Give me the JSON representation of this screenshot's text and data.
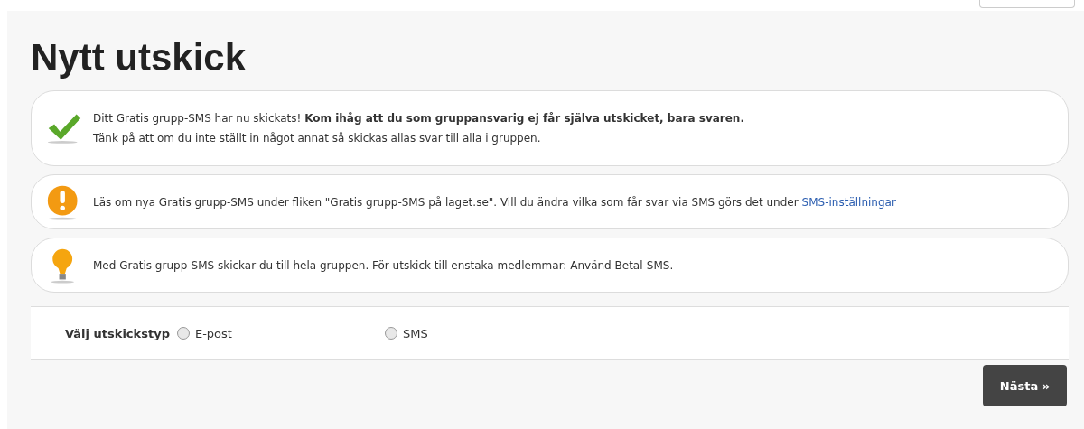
{
  "title": "Nytt utskick",
  "notices": [
    {
      "kind": "success",
      "lines": [
        "Ditt Gratis grupp-SMS har nu skickats! **Kom ihåg att du som gruppansvarig ej får själva utskicket, bara svaren.**",
        "Tänk på att om du inte ställt in något annat så skickas allas svar till alla i gruppen."
      ]
    },
    {
      "kind": "warning",
      "lines": [
        "Läs om nya Gratis grupp-SMS under fliken \"Gratis grupp-SMS på laget.se\". Vill du ändra vilka som får svar via SMS görs det under"
      ],
      "link": "SMS-inställningar"
    },
    {
      "kind": "tip",
      "lines": [
        "Med Gratis grupp-SMS skickar du till hela gruppen. För utskick till enstaka medlemmar: Använd Betal-SMS."
      ]
    }
  ],
  "send_type": {
    "label": "Välj utskickstyp",
    "options": [
      {
        "label": "E-post",
        "selected": false
      },
      {
        "label": "SMS",
        "selected": false
      }
    ]
  },
  "next_button": "Nästa »"
}
